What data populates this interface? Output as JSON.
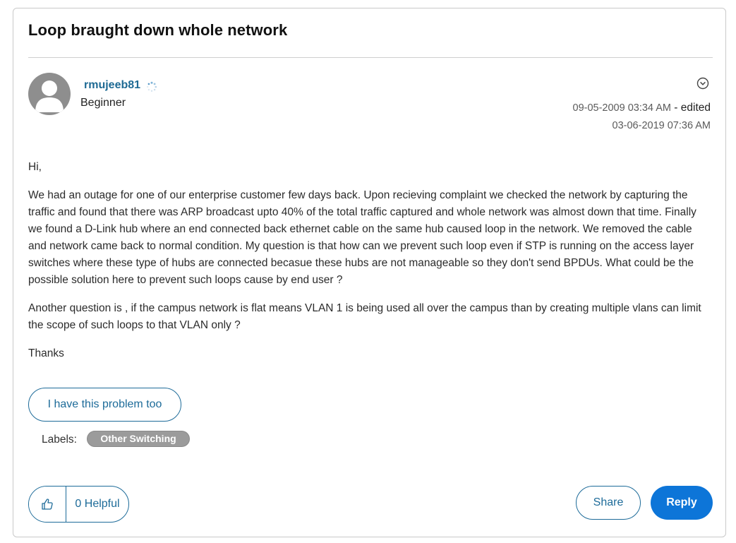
{
  "post": {
    "title": "Loop braught down whole network",
    "author": {
      "name": "rmujeeb81",
      "rank": "Beginner"
    },
    "posted_date": "09-05-2009 03:34 AM",
    "edited_label": " - edited",
    "edited_date": "03-06-2019 07:36 AM",
    "body": [
      "Hi,",
      "We had an outage for one of our enterprise customer few days back. Upon recieving complaint we checked the network by capturing the traffic and found that there was ARP broadcast upto 40% of the total traffic captured and whole network was almost down that time. Finally we found a D-Link hub where an end connected back ethernet cable on the same hub caused loop in the network. We removed the cable and network came back to normal condition. My question is that how can we prevent such loop even if STP is running on the access layer switches where these type of hubs are connected becasue these hubs are not manageable so they don't send BPDUs. What could be the possible solution here to prevent such loops cause by end user ?",
      "Another question is , if the campus network is flat means VLAN 1 is being used all over the campus than by creating multiple vlans can limit the scope of such loops to that VLAN only ?",
      "Thanks"
    ]
  },
  "actions": {
    "problem_too_label": "I have this problem too",
    "labels_caption": "Labels:",
    "labels": [
      "Other Switching"
    ],
    "helpful_label": "0 Helpful",
    "share_label": "Share",
    "reply_label": "Reply"
  },
  "icons": {
    "avatar": "user-silhouette-icon",
    "rank": "spinner-rank-icon",
    "options": "chevron-down-circle-icon",
    "helpful": "thumbs-up-icon"
  },
  "colors": {
    "link": "#1e6a94",
    "accent": "#0d75d8",
    "label_pill": "#9b9b9b"
  }
}
